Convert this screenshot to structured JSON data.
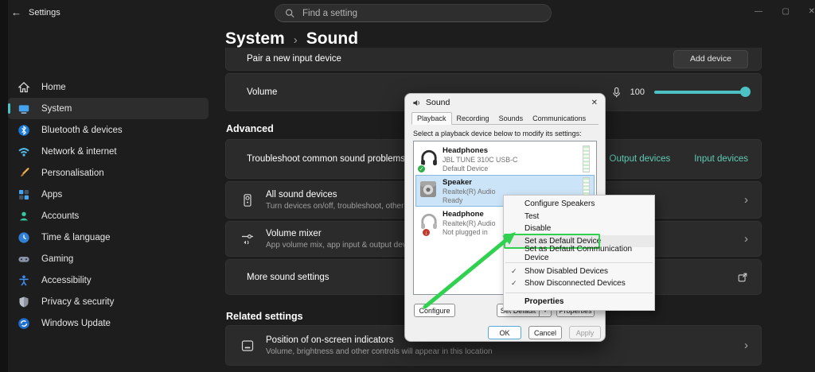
{
  "titlebar": {
    "back_glyph": "←",
    "app_title": "Settings",
    "search_placeholder": "Find a setting",
    "win_min": "—",
    "win_max": "▢",
    "win_close": "✕"
  },
  "breadcrumb": {
    "parent": "System",
    "separator": "›",
    "current": "Sound"
  },
  "sidebar": {
    "items": [
      {
        "label": "Home",
        "icon": "home-icon",
        "selected": false
      },
      {
        "label": "System",
        "icon": "system-icon",
        "selected": true
      },
      {
        "label": "Bluetooth & devices",
        "icon": "bluetooth-icon",
        "selected": false
      },
      {
        "label": "Network & internet",
        "icon": "wifi-icon",
        "selected": false
      },
      {
        "label": "Personalisation",
        "icon": "brush-icon",
        "selected": false
      },
      {
        "label": "Apps",
        "icon": "apps-icon",
        "selected": false
      },
      {
        "label": "Accounts",
        "icon": "person-icon",
        "selected": false
      },
      {
        "label": "Time & language",
        "icon": "clock-icon",
        "selected": false
      },
      {
        "label": "Gaming",
        "icon": "gamepad-icon",
        "selected": false
      },
      {
        "label": "Accessibility",
        "icon": "accessibility-icon",
        "selected": false
      },
      {
        "label": "Privacy & security",
        "icon": "shield-icon",
        "selected": false
      },
      {
        "label": "Windows Update",
        "icon": "update-icon",
        "selected": false
      }
    ]
  },
  "page": {
    "chevron_glyph": "›",
    "pair_row": {
      "label": "Pair a new input device",
      "button_label": "Add device"
    },
    "volume_row": {
      "label": "Volume",
      "value": "100"
    },
    "advanced_header": "Advanced",
    "troubleshoot_row": {
      "title": "Troubleshoot common sound problems",
      "links": [
        {
          "label": "Output devices"
        },
        {
          "label": "Input devices"
        }
      ]
    },
    "all_devices_row": {
      "title": "All sound devices",
      "description": "Turn devices on/off, troubleshoot, other options"
    },
    "volume_mixer_row": {
      "title": "Volume mixer",
      "description": "App volume mix, app input & output devices"
    },
    "more_sound_row": {
      "title": "More sound settings"
    },
    "related_header": "Related settings",
    "position_row": {
      "title": "Position of on-screen indicators",
      "description": "Volume, brightness and other controls will appear in this location"
    }
  },
  "dialog": {
    "title": "Sound",
    "close_glyph": "✕",
    "tabs": [
      {
        "label": "Playback",
        "active": true
      },
      {
        "label": "Recording",
        "active": false
      },
      {
        "label": "Sounds",
        "active": false
      },
      {
        "label": "Communications",
        "active": false
      }
    ],
    "instruction": "Select a playback device below to modify its settings:",
    "devices": [
      {
        "name": "Headphones",
        "detail": "JBL TUNE 310C USB-C",
        "status": "Default Device"
      },
      {
        "name": "Speaker",
        "detail": "Realtek(R) Audio",
        "status": "Ready"
      },
      {
        "name": "Headphone",
        "detail": "Realtek(R) Audio",
        "status": "Not plugged in"
      }
    ],
    "buttons": {
      "configure": "Configure",
      "set_default": "Set Default",
      "dropdown_glyph": "▾",
      "properties": "Properties",
      "ok": "OK",
      "cancel": "Cancel",
      "apply": "Apply"
    }
  },
  "context_menu": {
    "check_glyph": "✓",
    "items": [
      {
        "label": "Configure Speakers"
      },
      {
        "label": "Test"
      },
      {
        "label": "Disable"
      },
      {
        "label": "Set as Default Device",
        "highlighted": true
      },
      {
        "label": "Set as Default Communication Device"
      },
      {
        "label": "Show Disabled Devices",
        "checked": true
      },
      {
        "label": "Show Disconnected Devices",
        "checked": true
      },
      {
        "label": "Properties",
        "bold": true
      }
    ]
  },
  "colors": {
    "accent": "#4cc2c4",
    "link": "#5fcbb6",
    "annotation_green": "#2fd14e",
    "selected_device_bg": "#cce4f7"
  }
}
